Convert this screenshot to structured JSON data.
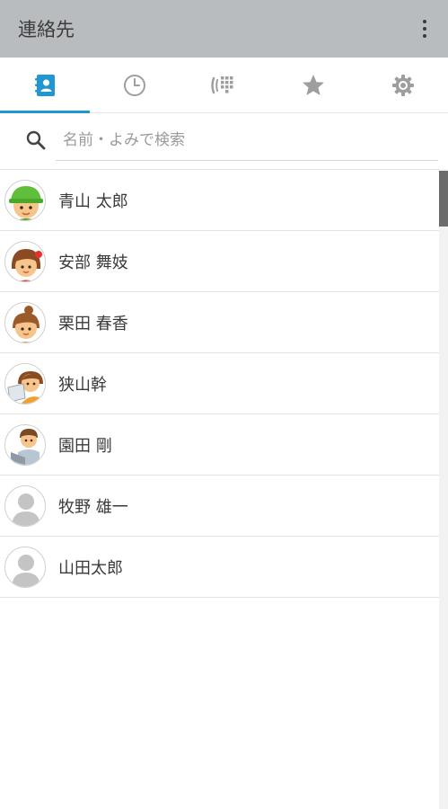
{
  "appbar": {
    "title": "連絡先",
    "menu_icon": "more-vert-icon"
  },
  "tabs": [
    {
      "icon": "contacts-book-icon",
      "active": true
    },
    {
      "icon": "clock-history-icon",
      "active": false
    },
    {
      "icon": "dialpad-icon",
      "active": false
    },
    {
      "icon": "star-favorite-icon",
      "active": false
    },
    {
      "icon": "gear-settings-icon",
      "active": false
    }
  ],
  "search": {
    "placeholder": "名前・よみで検索",
    "value": ""
  },
  "contacts": [
    {
      "name": "青山 太郎",
      "avatar": "avatar-boy-green-cap"
    },
    {
      "name": "安部 舞妓",
      "avatar": "avatar-girl-red-bow"
    },
    {
      "name": "栗田 春香",
      "avatar": "avatar-girl-bun"
    },
    {
      "name": "狭山幹",
      "avatar": "avatar-person-laptop"
    },
    {
      "name": "園田 剛",
      "avatar": "avatar-man-laptop"
    },
    {
      "name": "牧野 雄一",
      "avatar": "avatar-default"
    },
    {
      "name": "山田太郎",
      "avatar": "avatar-default"
    }
  ],
  "colors": {
    "appbar": "#b8bcbf",
    "accent": "#2196d3",
    "icon_gray": "#9e9e9e"
  }
}
